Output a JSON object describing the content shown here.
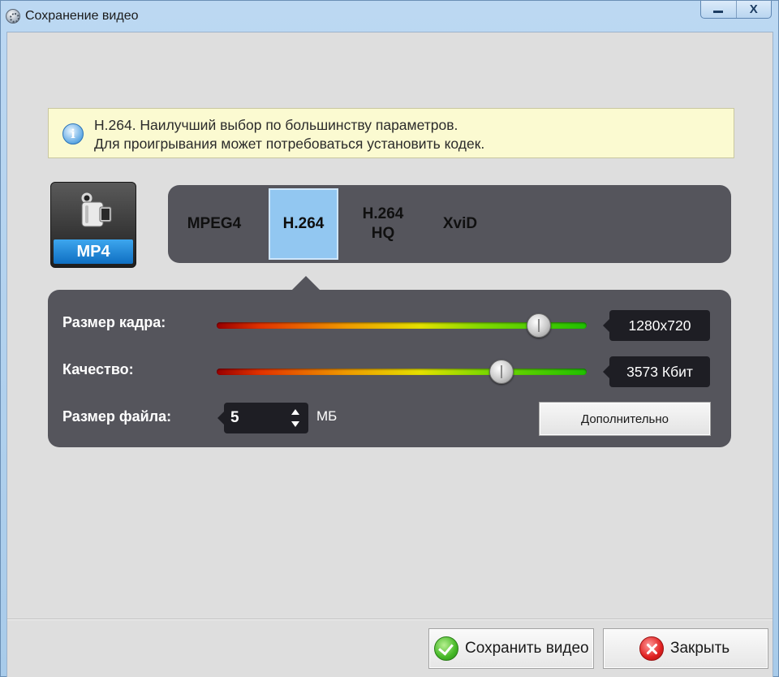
{
  "window": {
    "title": "Сохранение видео",
    "minimize_label": "_",
    "close_label": "X"
  },
  "info": {
    "icon": "info-icon",
    "icon_glyph": "i",
    "line1": "H.264. Наилучший выбор по большинству параметров.",
    "line2": "Для проигрывания может потребоваться установить кодек."
  },
  "format": {
    "icon": "video-camera-icon",
    "label": "MP4"
  },
  "codecs": {
    "selected": "H.264",
    "items": [
      {
        "label": "MPEG4"
      },
      {
        "label": "H.264"
      },
      {
        "label": "H.264 HQ"
      },
      {
        "label": "XviD"
      }
    ]
  },
  "settings": {
    "frame_size": {
      "label": "Размер кадра:",
      "value": "1280x720",
      "slider_fraction": 0.87
    },
    "quality": {
      "label": "Качество:",
      "value": "3573 Кбит",
      "slider_fraction": 0.77
    },
    "file_size": {
      "label": "Размер файла:",
      "value": "5",
      "unit": "МБ"
    },
    "advanced_button": "Дополнительно"
  },
  "footer": {
    "save_button": "Сохранить видео",
    "close_button": "Закрыть"
  }
}
